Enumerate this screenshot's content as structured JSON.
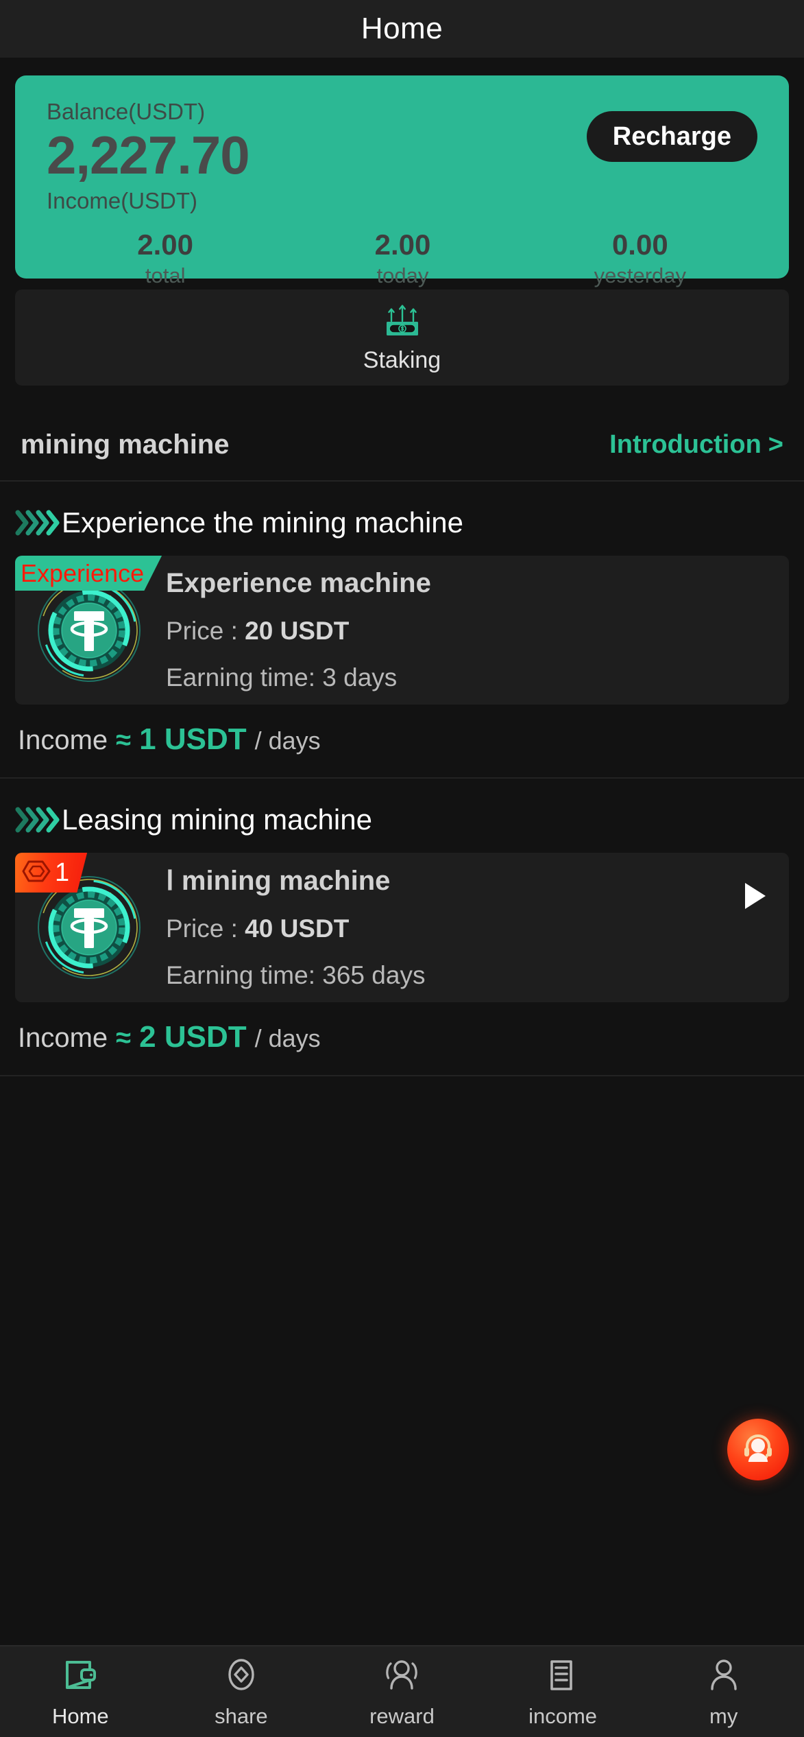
{
  "header": {
    "title": "Home"
  },
  "balance": {
    "balance_label": "Balance(USDT)",
    "balance_amount": "2,227.70",
    "recharge_label": "Recharge",
    "income_label": "Income(USDT)",
    "stats": [
      {
        "value": "2.00",
        "label": "total"
      },
      {
        "value": "2.00",
        "label": "today"
      },
      {
        "value": "0.00",
        "label": "yesterday"
      }
    ],
    "accent_color": "#2cb894"
  },
  "staking": {
    "label": "Staking",
    "icon": "money-arrows-icon"
  },
  "section": {
    "title": "mining machine",
    "link_label": "Introduction",
    "link_chevron": ">"
  },
  "groups": [
    {
      "title": "Experience the mining machine",
      "card": {
        "badge": "Experience",
        "badge_type": "experience",
        "title": "Experience machine",
        "price_label": "Price :",
        "price_value": "20 USDT",
        "time_label": "Earning time:",
        "time_value": "3",
        "time_unit": "days",
        "has_arrow": false
      },
      "income": {
        "prefix": "Income",
        "approx": "≈",
        "value": "1 USDT",
        "suffix": "/ days"
      }
    },
    {
      "title": "Leasing mining machine",
      "card": {
        "badge": "1",
        "badge_type": "level",
        "title": "Ⅰ  mining machine",
        "price_label": "Price :",
        "price_value": "40 USDT",
        "time_label": "Earning time:",
        "time_value": "365",
        "time_unit": "days",
        "has_arrow": true
      },
      "income": {
        "prefix": "Income",
        "approx": "≈",
        "value": "2 USDT",
        "suffix": "/ days"
      }
    }
  ],
  "support": {
    "icon": "headset-agent-icon"
  },
  "bottomnav": {
    "items": [
      {
        "label": "Home",
        "icon": "wallet-icon",
        "active": true
      },
      {
        "label": "share",
        "icon": "diamond-icon",
        "active": false
      },
      {
        "label": "reward",
        "icon": "people-icon",
        "active": false
      },
      {
        "label": "income",
        "icon": "list-icon",
        "active": false
      },
      {
        "label": "my",
        "icon": "person-icon",
        "active": false
      }
    ],
    "active_color": "#4cbd94",
    "inactive_color": "#b4b4b4"
  }
}
